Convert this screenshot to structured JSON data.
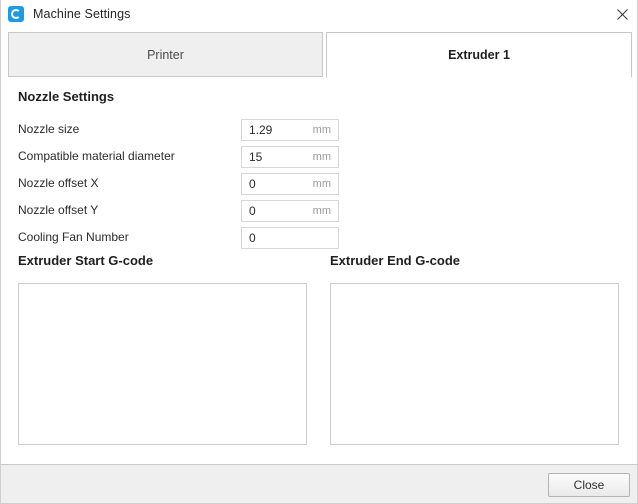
{
  "window": {
    "title": "Machine Settings",
    "app_icon": "cura-logo-icon",
    "close_icon": "close-icon"
  },
  "tabs": [
    {
      "id": "printer",
      "label": "Printer",
      "active": false
    },
    {
      "id": "extruder1",
      "label": "Extruder 1",
      "active": true
    }
  ],
  "extruder_tab": {
    "nozzle_settings": {
      "heading": "Nozzle Settings",
      "fields": [
        {
          "label": "Nozzle size",
          "value": "1.29",
          "unit": "mm"
        },
        {
          "label": "Compatible material diameter",
          "value": "15",
          "unit": "mm"
        },
        {
          "label": "Nozzle offset X",
          "value": "0",
          "unit": "mm"
        },
        {
          "label": "Nozzle offset Y",
          "value": "0",
          "unit": "mm"
        },
        {
          "label": "Cooling Fan Number",
          "value": "0",
          "unit": ""
        }
      ]
    },
    "gcode": {
      "start": {
        "heading": "Extruder Start G-code",
        "value": ""
      },
      "end": {
        "heading": "Extruder End G-code",
        "value": ""
      }
    }
  },
  "footer": {
    "close_label": "Close"
  },
  "colors": {
    "accent": "#1e9ae0",
    "tab_inactive_bg": "#efefef",
    "tab_active_bg": "#ffffff",
    "footer_bg": "#efefef",
    "border": "#c8c8c8",
    "text": "#2b2b2b",
    "unit_text": "#9a9a9a"
  }
}
